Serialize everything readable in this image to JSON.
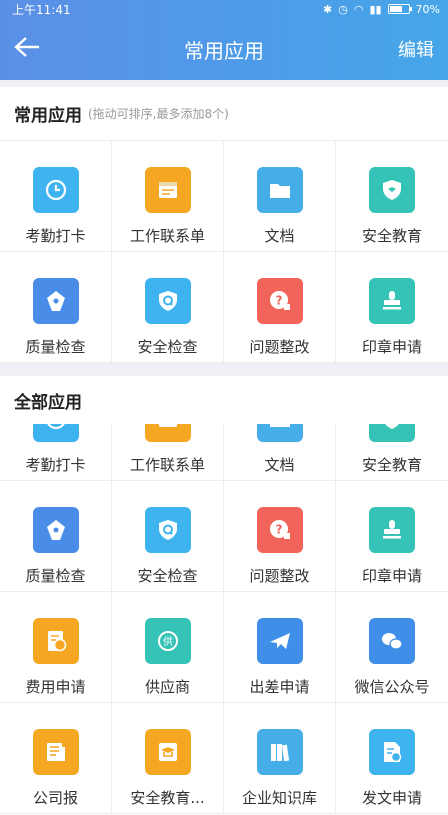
{
  "status": {
    "time": "上午11:41",
    "battery": "70%",
    "battery_level": 0.7
  },
  "header": {
    "title": "常用应用",
    "edit_label": "编辑"
  },
  "favorites": {
    "title": "常用应用",
    "hint": "(拖动可排序,最多添加8个)",
    "items": [
      {
        "label": "考勤打卡",
        "icon": "clock-icon",
        "color": "#3fb2f0"
      },
      {
        "label": "工作联系单",
        "icon": "calendar-icon",
        "color": "#f5a623"
      },
      {
        "label": "文档",
        "icon": "folder-icon",
        "color": "#45aee8"
      },
      {
        "label": "安全教育",
        "icon": "shield-icon",
        "color": "#34c3b6"
      },
      {
        "label": "质量检查",
        "icon": "tag-icon",
        "color": "#4a8de8"
      },
      {
        "label": "安全检查",
        "icon": "shield-q-icon",
        "color": "#3fb2f0"
      },
      {
        "label": "问题整改",
        "icon": "question-icon",
        "color": "#f0645a"
      },
      {
        "label": "印章申请",
        "icon": "stamp-icon",
        "color": "#34c3b6"
      }
    ]
  },
  "all_apps": {
    "title": "全部应用",
    "items": [
      {
        "label": "考勤打卡",
        "icon": "clock-icon",
        "color": "#3fb2f0"
      },
      {
        "label": "工作联系单",
        "icon": "calendar-icon",
        "color": "#f5a623"
      },
      {
        "label": "文档",
        "icon": "folder-icon",
        "color": "#45aee8"
      },
      {
        "label": "安全教育",
        "icon": "shield-icon",
        "color": "#34c3b6"
      },
      {
        "label": "质量检查",
        "icon": "tag-icon",
        "color": "#4a8de8"
      },
      {
        "label": "安全检查",
        "icon": "shield-q-icon",
        "color": "#3fb2f0"
      },
      {
        "label": "问题整改",
        "icon": "question-icon",
        "color": "#f0645a"
      },
      {
        "label": "印章申请",
        "icon": "stamp-icon",
        "color": "#34c3b6"
      },
      {
        "label": "费用申请",
        "icon": "yen-doc-icon",
        "color": "#f5a623"
      },
      {
        "label": "供应商",
        "icon": "supplier-icon",
        "color": "#34c3b6"
      },
      {
        "label": "出差申请",
        "icon": "airplane-icon",
        "color": "#3f8fe8"
      },
      {
        "label": "微信公众号",
        "icon": "wechat-icon",
        "color": "#3f8fe8"
      },
      {
        "label": "公司报",
        "icon": "newspaper-icon",
        "color": "#f5a623"
      },
      {
        "label": "安全教育...",
        "icon": "graduation-icon",
        "color": "#f5a623"
      },
      {
        "label": "企业知识库",
        "icon": "books-icon",
        "color": "#45aee8"
      },
      {
        "label": "发文申请",
        "icon": "document-send-icon",
        "color": "#3fb2f0"
      }
    ]
  }
}
